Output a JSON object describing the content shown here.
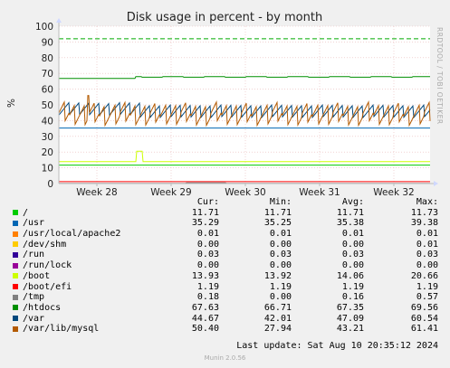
{
  "chart_data": {
    "type": "line",
    "title": "Disk usage in percent - by month",
    "ylabel": "%",
    "vertical_label": "RRDTOOL / TOBI OETIKER",
    "ylim": [
      0,
      100
    ],
    "yticks": [
      0,
      10,
      20,
      30,
      40,
      50,
      60,
      70,
      80,
      90,
      100
    ],
    "x_ticks": [
      "Week 28",
      "Week 29",
      "Week 30",
      "Week 31",
      "Week 32"
    ],
    "grid": true,
    "warning_level": 92,
    "column_headers": [
      "Cur:",
      "Min:",
      "Avg:",
      "Max:"
    ],
    "series": [
      {
        "name": "/",
        "color": "#00cc00",
        "cur": "11.71",
        "min": "11.71",
        "avg": "11.71",
        "max": "11.73"
      },
      {
        "name": "/usr",
        "color": "#0066b3",
        "cur": "35.29",
        "min": "35.25",
        "avg": "35.38",
        "max": "39.38"
      },
      {
        "name": "/usr/local/apache2",
        "color": "#ff8000",
        "cur": "0.01",
        "min": "0.01",
        "avg": "0.01",
        "max": "0.01"
      },
      {
        "name": "/dev/shm",
        "color": "#ffcc00",
        "cur": "0.00",
        "min": "0.00",
        "avg": "0.00",
        "max": "0.01"
      },
      {
        "name": "/run",
        "color": "#330099",
        "cur": "0.03",
        "min": "0.03",
        "avg": "0.03",
        "max": "0.03"
      },
      {
        "name": "/run/lock",
        "color": "#990099",
        "cur": "0.00",
        "min": "0.00",
        "avg": "0.00",
        "max": "0.00"
      },
      {
        "name": "/boot",
        "color": "#ccff00",
        "cur": "13.93",
        "min": "13.92",
        "avg": "14.06",
        "max": "20.66"
      },
      {
        "name": "/boot/efi",
        "color": "#ff0000",
        "cur": "1.19",
        "min": "1.19",
        "avg": "1.19",
        "max": "1.19"
      },
      {
        "name": "/tmp",
        "color": "#808080",
        "cur": "0.18",
        "min": "0.00",
        "avg": "0.16",
        "max": "0.57"
      },
      {
        "name": "/htdocs",
        "color": "#008f00",
        "cur": "67.63",
        "min": "66.71",
        "avg": "67.35",
        "max": "69.56"
      },
      {
        "name": "/var",
        "color": "#00487d",
        "cur": "44.67",
        "min": "42.01",
        "avg": "47.09",
        "max": "60.54"
      },
      {
        "name": "/var/lib/mysql",
        "color": "#b35a00",
        "cur": "50.40",
        "min": "27.94",
        "avg": "43.21",
        "max": "61.41"
      }
    ]
  },
  "last_update": "Last update: Sat Aug 10 20:35:12 2024",
  "footer": "Munin 2.0.56"
}
